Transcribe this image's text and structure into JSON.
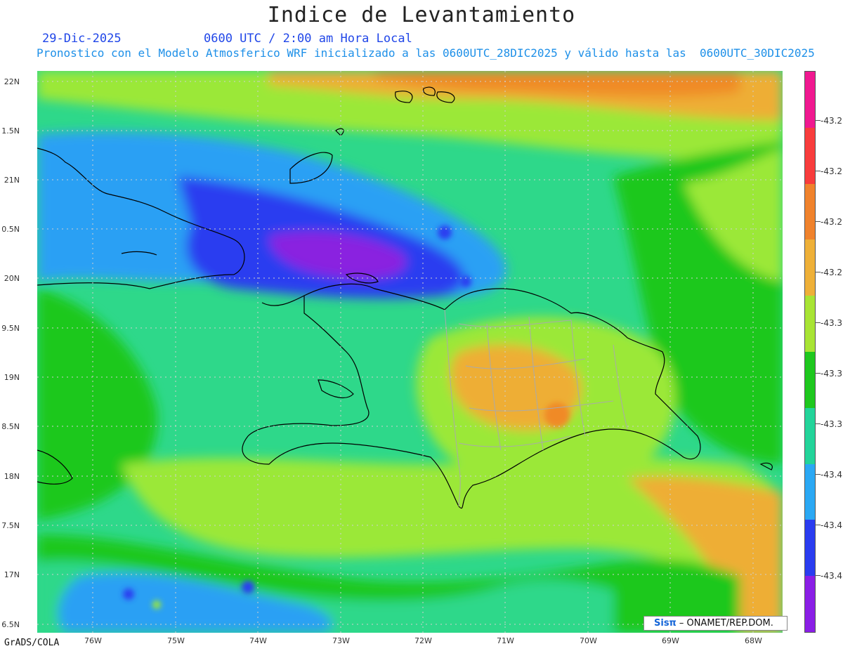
{
  "header": {
    "title": "Indice de Levantamiento",
    "date": "29-Dic-2025",
    "time": "0600 UTC / 2:00 am Hora Local",
    "description": "Pronostico con el Modelo Atmosferico WRF inicializado a las 0600UTC_28DIC2025 y válido hasta las  0600UTC_30DIC2025"
  },
  "map": {
    "lat_labels": [
      "22N",
      "1.5N",
      "21N",
      "0.5N",
      "20N",
      "9.5N",
      "19N",
      "8.5N",
      "18N",
      "7.5N",
      "17N",
      "6.5N"
    ],
    "lon_labels": [
      "76W",
      "75W",
      "74W",
      "73W",
      "72W",
      "71W",
      "70W",
      "69W",
      "68W"
    ],
    "colors": {
      "background": "#2ed88a",
      "lime": "#9be838",
      "green": "#1ec81e",
      "teal": "#22d49a",
      "light_blue": "#2aa0f4",
      "blue": "#2a3cf0",
      "purple": "#8a20e0",
      "yellow_orange": "#eeae36",
      "orange": "#f08a28",
      "border_country": "#000000",
      "border_province": "#aaaaaa"
    }
  },
  "colorbar": {
    "labels": [
      "-43.2",
      "-43.2",
      "-43.2",
      "-43.2",
      "-43.3",
      "-43.3",
      "-43.3",
      "-43.4",
      "-43.4",
      "-43.4"
    ],
    "colors": [
      "#f01890",
      "#f83c3c",
      "#f0822c",
      "#eeb038",
      "#a8e434",
      "#1ec81e",
      "#22d49a",
      "#2aa8f4",
      "#2a3cf0",
      "#8a1ee6"
    ]
  },
  "footer": {
    "software": "GrADS/COLA",
    "credit_logo": "Sisπ",
    "credit_text": "– ONAMET/REP.DOM."
  }
}
